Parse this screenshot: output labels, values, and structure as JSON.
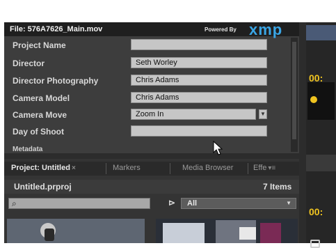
{
  "metadata_panel": {
    "file_title": "File: 576A7626_Main.mov",
    "powered_by": "Powered By",
    "logo": "xmp",
    "fields": [
      {
        "label": "Project Name",
        "value": ""
      },
      {
        "label": "Director",
        "value": "Seth Worley"
      },
      {
        "label": "Director Photography",
        "value": "Chris Adams"
      },
      {
        "label": "Camera Model",
        "value": "Chris Adams"
      },
      {
        "label": "Camera Move",
        "value": "Zoom In"
      },
      {
        "label": "Day of Shoot",
        "value": ""
      }
    ],
    "next_section_label": "Metadata"
  },
  "project_panel": {
    "tabs": [
      {
        "label": "Project: Untitled",
        "active": true
      },
      {
        "label": "Markers",
        "active": false
      },
      {
        "label": "Media Browser",
        "active": false
      },
      {
        "label": "Effe",
        "active": false
      }
    ],
    "bin_name": "Untitled.prproj",
    "item_count": "7 Items",
    "search": {
      "value": "",
      "placeholder": ""
    },
    "filter": {
      "selected": "All"
    }
  },
  "right_strip": {
    "timecode_1": "00:",
    "timecode_2": "00:"
  },
  "colors": {
    "accent_logo": "#3aa6e6",
    "timecode": "#f0c420"
  },
  "icons": [
    "search-icon",
    "filter-icon",
    "cursor-icon",
    "chevron-down-icon",
    "close-icon"
  ]
}
